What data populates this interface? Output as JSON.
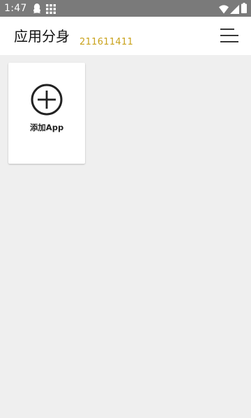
{
  "status_bar": {
    "time": "1:47",
    "left_icons": [
      "qq-penguin-icon",
      "app-grid-icon"
    ],
    "right_icons": [
      "wifi-icon",
      "signal-icon",
      "battery-icon"
    ]
  },
  "header": {
    "title": "应用分身",
    "id_text": "211611411",
    "id_color": "#c9a21b",
    "menu_icon": "menu-icon"
  },
  "main": {
    "cards": [
      {
        "label": "添加App",
        "icon": "add-circle-icon"
      }
    ]
  }
}
